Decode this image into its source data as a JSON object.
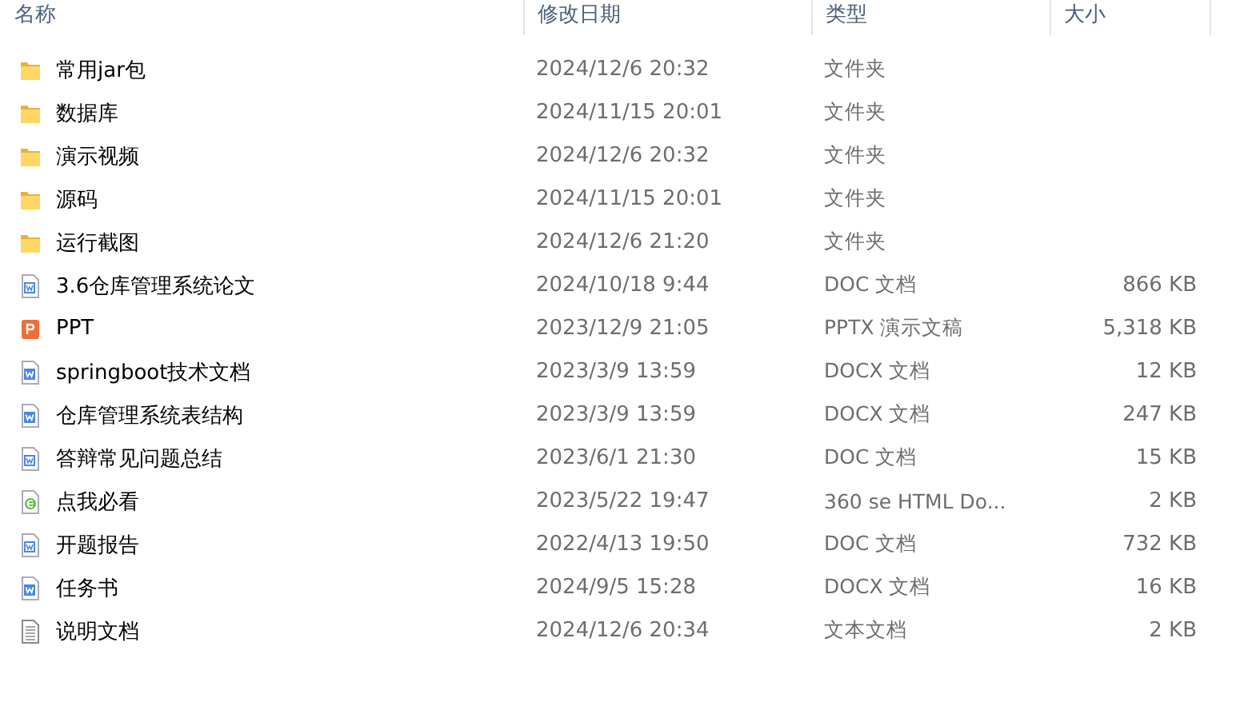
{
  "columns": [
    "名称",
    "修改日期",
    "类型",
    "大小"
  ],
  "files": [
    {
      "kind": "folder",
      "name": "常用jar包",
      "modified": "2024/12/6 20:32",
      "type": "文件夹"
    },
    {
      "kind": "folder",
      "name": "数据库",
      "modified": "2024/11/15 20:01",
      "type": "文件夹"
    },
    {
      "kind": "folder",
      "name": "演示视频",
      "modified": "2024/12/6 20:32",
      "type": "文件夹"
    },
    {
      "kind": "folder",
      "name": "源码",
      "modified": "2024/11/15 20:01",
      "type": "文件夹"
    },
    {
      "kind": "folder",
      "name": "运行截图",
      "modified": "2024/12/6 21:20",
      "type": "文件夹"
    },
    {
      "kind": "doc",
      "name": "3.6仓库管理系统论文",
      "modified": "2024/10/18 9:44",
      "type": "DOC 文档",
      "size": "866 KB"
    },
    {
      "kind": "ppt",
      "name": "PPT",
      "modified": "2023/12/9 21:05",
      "type": "PPTX 演示文稿",
      "size": "5,318 KB"
    },
    {
      "kind": "docx",
      "name": "springboot技术文档",
      "modified": "2023/3/9 13:59",
      "type": "DOCX 文档",
      "size": "12 KB"
    },
    {
      "kind": "docx",
      "name": "仓库管理系统表结构",
      "modified": "2023/3/9 13:59",
      "type": "DOCX 文档",
      "size": "247 KB"
    },
    {
      "kind": "doc",
      "name": "答辩常见问题总结",
      "modified": "2023/6/1 21:30",
      "type": "DOC 文档",
      "size": "15 KB"
    },
    {
      "kind": "html",
      "name": "点我必看",
      "modified": "2023/5/22 19:47",
      "type": "360 se HTML Do...",
      "size": "2 KB"
    },
    {
      "kind": "doc",
      "name": "开题报告",
      "modified": "2022/4/13 19:50",
      "type": "DOC 文档",
      "size": "732 KB"
    },
    {
      "kind": "docx",
      "name": "任务书",
      "modified": "2024/9/5 15:28",
      "type": "DOCX 文档",
      "size": "16 KB"
    },
    {
      "kind": "txt",
      "name": "说明文档",
      "modified": "2024/12/6 20:34",
      "type": "文本文档",
      "size": "2 KB"
    }
  ]
}
